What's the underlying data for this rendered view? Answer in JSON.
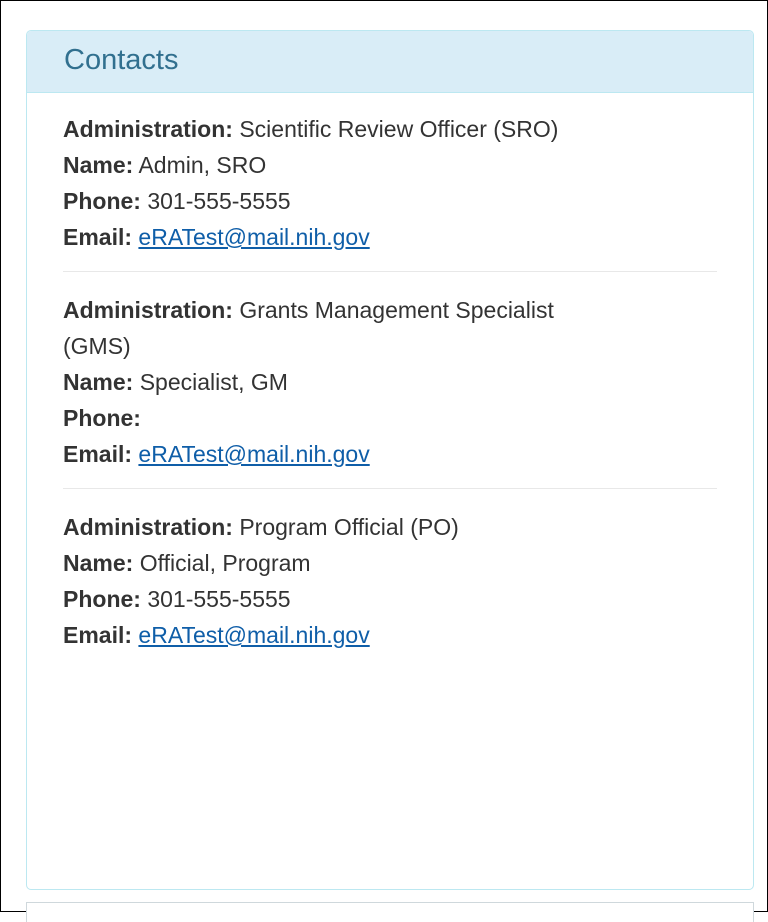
{
  "panel": {
    "title": "Contacts"
  },
  "labels": {
    "administration": "Administration:",
    "name": "Name:",
    "phone": "Phone:",
    "email": "Email:"
  },
  "contacts": [
    {
      "administration": "Scientific Review Officer (SRO)",
      "name": "Admin, SRO",
      "phone": "301-555-5555",
      "email": "eRATest@mail.nih.gov"
    },
    {
      "administration": "Grants Management Specialist (GMS)",
      "name": "Specialist, GM",
      "phone": "",
      "email": "eRATest@mail.nih.gov"
    },
    {
      "administration": "Program Official (PO)",
      "name": "Official, Program",
      "phone": "301-555-5555",
      "email": "eRATest@mail.nih.gov"
    }
  ],
  "colors": {
    "heading_bg": "#d9edf7",
    "heading_text": "#31708f",
    "panel_border": "#bce8f1",
    "link": "#0f5ea8"
  }
}
